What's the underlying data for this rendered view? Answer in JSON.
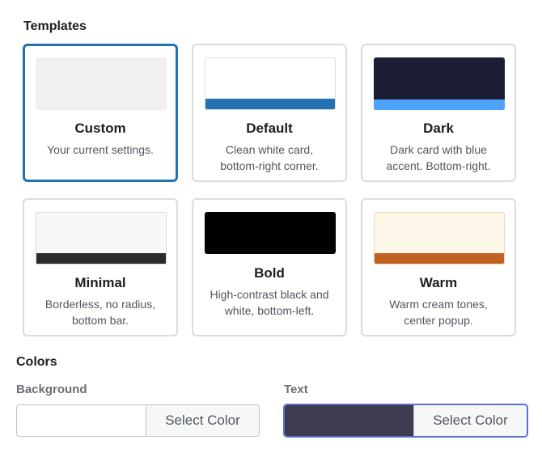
{
  "templates": {
    "title": "Templates",
    "items": [
      {
        "name": "Custom",
        "description": "Your current settings.",
        "selected": true
      },
      {
        "name": "Default",
        "description": "Clean white card, bottom-right corner."
      },
      {
        "name": "Dark",
        "description": "Dark card with blue accent. Bottom-right."
      },
      {
        "name": "Minimal",
        "description": "Borderless, no radius, bottom bar."
      },
      {
        "name": "Bold",
        "description": "High-contrast black and white, bottom-left."
      },
      {
        "name": "Warm",
        "description": "Warm cream tones, center popup."
      }
    ]
  },
  "colors": {
    "title": "Colors",
    "background": {
      "label": "Background",
      "value": "#ffffff",
      "button_label": "Select Color"
    },
    "text": {
      "label": "Text",
      "value": "#3d3b4f",
      "button_label": "Select Color"
    }
  },
  "theme": {
    "selected_border": "#2271b1",
    "focus_border": "#5b6fd6"
  }
}
